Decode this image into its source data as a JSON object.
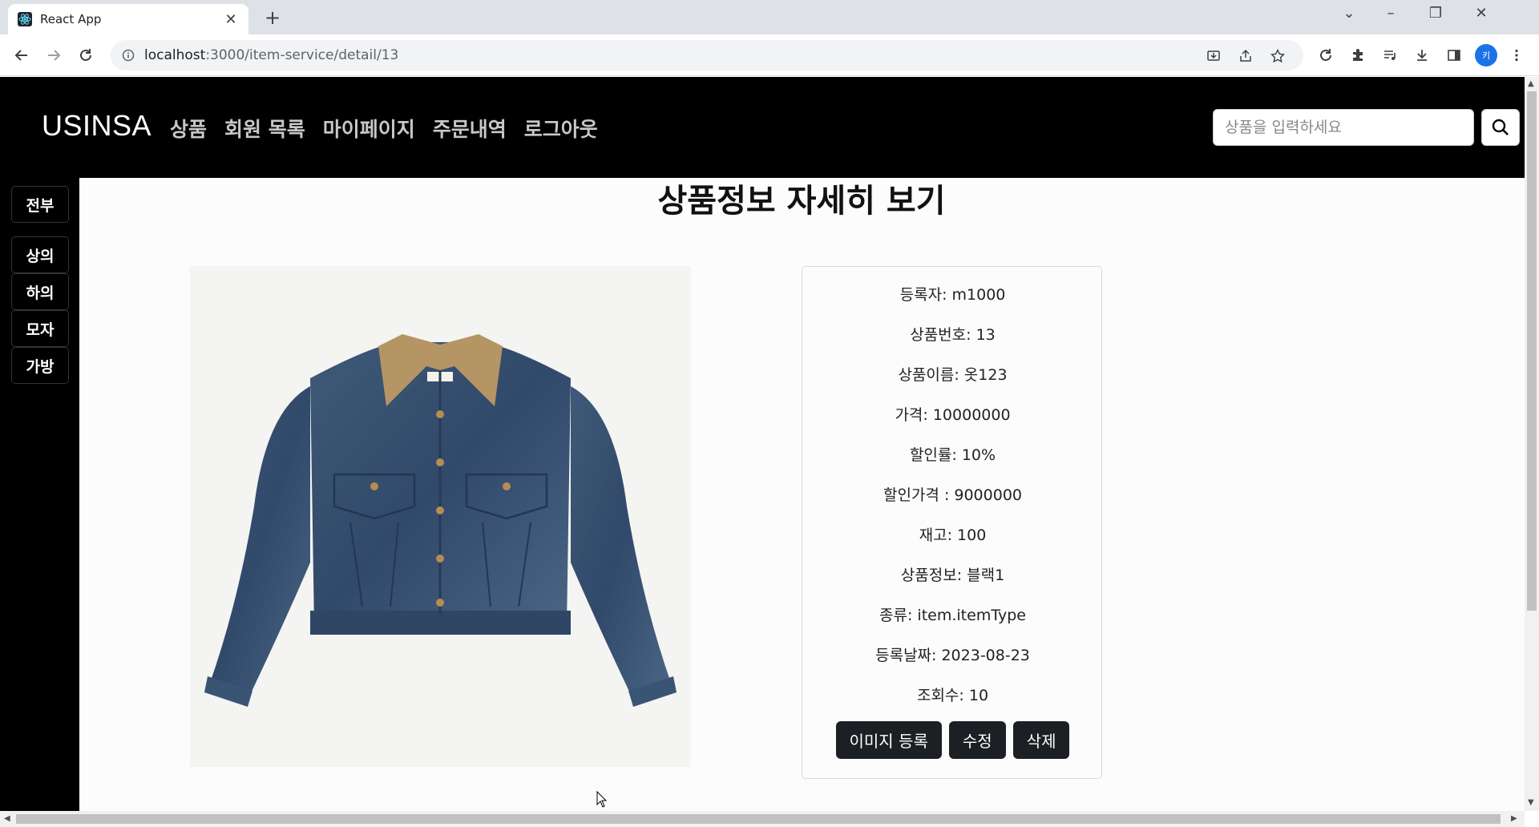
{
  "browser": {
    "tab_title": "React App",
    "url_host": "localhost",
    "url_path": ":3000/item-service/detail/13",
    "profile_initial": "키"
  },
  "site": {
    "brand": "USINSA",
    "nav": [
      "상품",
      "회원 목록",
      "마이페이지",
      "주문내역",
      "로그아웃"
    ],
    "search_placeholder": "상품을 입력하세요",
    "categories": [
      "전부",
      "상의",
      "하의",
      "모자",
      "가방"
    ]
  },
  "page": {
    "title": "상품정보 자세히 보기",
    "product_image": "denim-jacket-with-corduroy-collar",
    "details": [
      "등록자: m1000",
      "상품번호: 13",
      "상품이름: 옷123",
      "가격: 10000000",
      "할인률: 10%",
      "할인가격 : 9000000",
      "재고: 100",
      "상품정보: 블랙1",
      "종류: item.itemType",
      "등록날짜: 2023-08-23",
      "조회수: 10"
    ],
    "buttons": {
      "upload_image": "이미지 등록",
      "edit": "수정",
      "delete": "삭제"
    }
  },
  "colors": {
    "header_bg": "#000000",
    "button_bg": "#1c1f23",
    "page_bg": "#fcfcfc"
  }
}
